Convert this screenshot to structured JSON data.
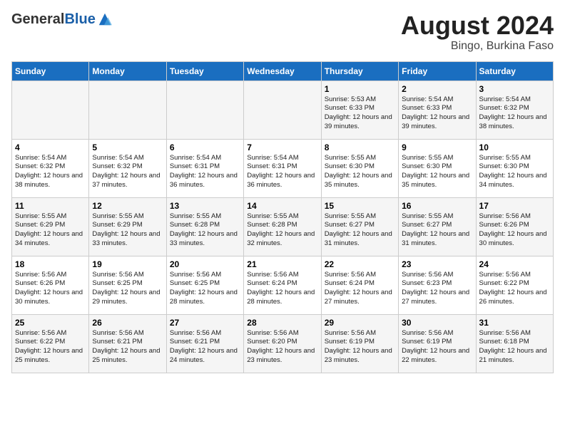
{
  "header": {
    "logo_general": "General",
    "logo_blue": "Blue",
    "month_year": "August 2024",
    "location": "Bingo, Burkina Faso"
  },
  "calendar": {
    "days_of_week": [
      "Sunday",
      "Monday",
      "Tuesday",
      "Wednesday",
      "Thursday",
      "Friday",
      "Saturday"
    ],
    "weeks": [
      [
        {
          "day": "",
          "info": ""
        },
        {
          "day": "",
          "info": ""
        },
        {
          "day": "",
          "info": ""
        },
        {
          "day": "",
          "info": ""
        },
        {
          "day": "1",
          "info": "Sunrise: 5:53 AM\nSunset: 6:33 PM\nDaylight: 12 hours and 39 minutes."
        },
        {
          "day": "2",
          "info": "Sunrise: 5:54 AM\nSunset: 6:33 PM\nDaylight: 12 hours and 39 minutes."
        },
        {
          "day": "3",
          "info": "Sunrise: 5:54 AM\nSunset: 6:32 PM\nDaylight: 12 hours and 38 minutes."
        }
      ],
      [
        {
          "day": "4",
          "info": "Sunrise: 5:54 AM\nSunset: 6:32 PM\nDaylight: 12 hours and 38 minutes."
        },
        {
          "day": "5",
          "info": "Sunrise: 5:54 AM\nSunset: 6:32 PM\nDaylight: 12 hours and 37 minutes."
        },
        {
          "day": "6",
          "info": "Sunrise: 5:54 AM\nSunset: 6:31 PM\nDaylight: 12 hours and 36 minutes."
        },
        {
          "day": "7",
          "info": "Sunrise: 5:54 AM\nSunset: 6:31 PM\nDaylight: 12 hours and 36 minutes."
        },
        {
          "day": "8",
          "info": "Sunrise: 5:55 AM\nSunset: 6:30 PM\nDaylight: 12 hours and 35 minutes."
        },
        {
          "day": "9",
          "info": "Sunrise: 5:55 AM\nSunset: 6:30 PM\nDaylight: 12 hours and 35 minutes."
        },
        {
          "day": "10",
          "info": "Sunrise: 5:55 AM\nSunset: 6:30 PM\nDaylight: 12 hours and 34 minutes."
        }
      ],
      [
        {
          "day": "11",
          "info": "Sunrise: 5:55 AM\nSunset: 6:29 PM\nDaylight: 12 hours and 34 minutes."
        },
        {
          "day": "12",
          "info": "Sunrise: 5:55 AM\nSunset: 6:29 PM\nDaylight: 12 hours and 33 minutes."
        },
        {
          "day": "13",
          "info": "Sunrise: 5:55 AM\nSunset: 6:28 PM\nDaylight: 12 hours and 33 minutes."
        },
        {
          "day": "14",
          "info": "Sunrise: 5:55 AM\nSunset: 6:28 PM\nDaylight: 12 hours and 32 minutes."
        },
        {
          "day": "15",
          "info": "Sunrise: 5:55 AM\nSunset: 6:27 PM\nDaylight: 12 hours and 31 minutes."
        },
        {
          "day": "16",
          "info": "Sunrise: 5:55 AM\nSunset: 6:27 PM\nDaylight: 12 hours and 31 minutes."
        },
        {
          "day": "17",
          "info": "Sunrise: 5:56 AM\nSunset: 6:26 PM\nDaylight: 12 hours and 30 minutes."
        }
      ],
      [
        {
          "day": "18",
          "info": "Sunrise: 5:56 AM\nSunset: 6:26 PM\nDaylight: 12 hours and 30 minutes."
        },
        {
          "day": "19",
          "info": "Sunrise: 5:56 AM\nSunset: 6:25 PM\nDaylight: 12 hours and 29 minutes."
        },
        {
          "day": "20",
          "info": "Sunrise: 5:56 AM\nSunset: 6:25 PM\nDaylight: 12 hours and 28 minutes."
        },
        {
          "day": "21",
          "info": "Sunrise: 5:56 AM\nSunset: 6:24 PM\nDaylight: 12 hours and 28 minutes."
        },
        {
          "day": "22",
          "info": "Sunrise: 5:56 AM\nSunset: 6:24 PM\nDaylight: 12 hours and 27 minutes."
        },
        {
          "day": "23",
          "info": "Sunrise: 5:56 AM\nSunset: 6:23 PM\nDaylight: 12 hours and 27 minutes."
        },
        {
          "day": "24",
          "info": "Sunrise: 5:56 AM\nSunset: 6:22 PM\nDaylight: 12 hours and 26 minutes."
        }
      ],
      [
        {
          "day": "25",
          "info": "Sunrise: 5:56 AM\nSunset: 6:22 PM\nDaylight: 12 hours and 25 minutes."
        },
        {
          "day": "26",
          "info": "Sunrise: 5:56 AM\nSunset: 6:21 PM\nDaylight: 12 hours and 25 minutes."
        },
        {
          "day": "27",
          "info": "Sunrise: 5:56 AM\nSunset: 6:21 PM\nDaylight: 12 hours and 24 minutes."
        },
        {
          "day": "28",
          "info": "Sunrise: 5:56 AM\nSunset: 6:20 PM\nDaylight: 12 hours and 23 minutes."
        },
        {
          "day": "29",
          "info": "Sunrise: 5:56 AM\nSunset: 6:19 PM\nDaylight: 12 hours and 23 minutes."
        },
        {
          "day": "30",
          "info": "Sunrise: 5:56 AM\nSunset: 6:19 PM\nDaylight: 12 hours and 22 minutes."
        },
        {
          "day": "31",
          "info": "Sunrise: 5:56 AM\nSunset: 6:18 PM\nDaylight: 12 hours and 21 minutes."
        }
      ]
    ]
  }
}
